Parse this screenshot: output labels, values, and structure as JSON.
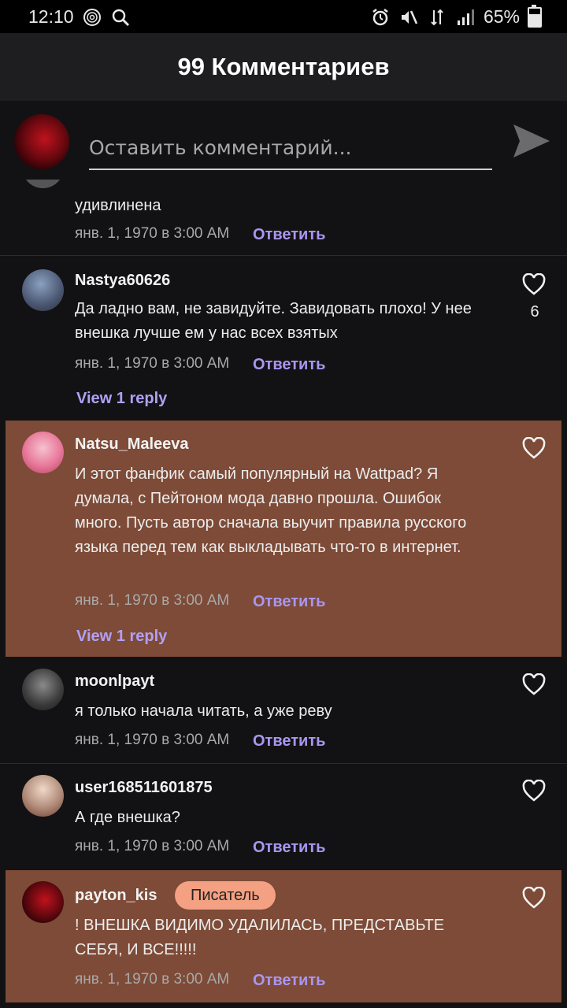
{
  "status_bar": {
    "time": "12:10",
    "battery": "65%",
    "battery_level": 0.65,
    "icons": [
      "fingerprint-icon",
      "search-icon",
      "alarm-icon",
      "mute-icon",
      "data-icon",
      "signal-icon",
      "battery-icon"
    ]
  },
  "header": {
    "title": "99 Комментариев"
  },
  "composer": {
    "placeholder": "Оставить комментарий..."
  },
  "comments": [
    {
      "username": "",
      "text": "удивлинена",
      "date": "янв. 1, 1970 в 3:00 AM",
      "reply_label": "Ответить",
      "avatar_color": "#6b6b6b"
    },
    {
      "username": "Nastya60626",
      "text": "Да ладно вам, не завидуйте. Завидовать плохо! У нее внешка лучше ем у нас всех взятых",
      "date": "янв. 1, 1970 в 3:00 AM",
      "reply_label": "Ответить",
      "likes": "6",
      "view_replies": "View 1 reply",
      "avatar_color": "#5a6d8a"
    },
    {
      "username": "Natsu_Maleeva",
      "text": "И этот фанфик самый популярный на Wattpad? Я думала, с Пейтоном мода давно прошла. Ошибок много. Пусть автор сначала выучит правила русского языка перед тем как выкладывать что-то в интернет.",
      "date": "янв. 1, 1970 в 3:00 AM",
      "reply_label": "Ответить",
      "view_replies": "View 1 reply",
      "avatar_color": "#e8789a",
      "highlighted": true
    },
    {
      "username": "moonlpayt",
      "text": "я только начала читать,  а уже реву",
      "date": "янв. 1, 1970 в 3:00 AM",
      "reply_label": "Ответить",
      "avatar_color": "#3a3a3a"
    },
    {
      "username": "user168511601875",
      "text": "А где внешка?",
      "date": "янв. 1, 1970 в 3:00 AM",
      "reply_label": "Ответить",
      "avatar_color": "#b08a78"
    },
    {
      "username": "payton_kis",
      "badge": "Писатель",
      "text": "! ВНЕШКА ВИДИМО УДАЛИЛАСЬ, ПРЕДСТАВЬТЕ СЕБЯ, И ВСЕ!!!!!",
      "date": "янв. 1, 1970 в 3:00 AM",
      "reply_label": "Ответить",
      "avatar_color": "#7a0a12",
      "highlighted": true
    }
  ],
  "colors": {
    "background": "#121214",
    "highlight": "#7d4b37",
    "reply_link": "#a996f1",
    "badge": "#f4a082"
  }
}
